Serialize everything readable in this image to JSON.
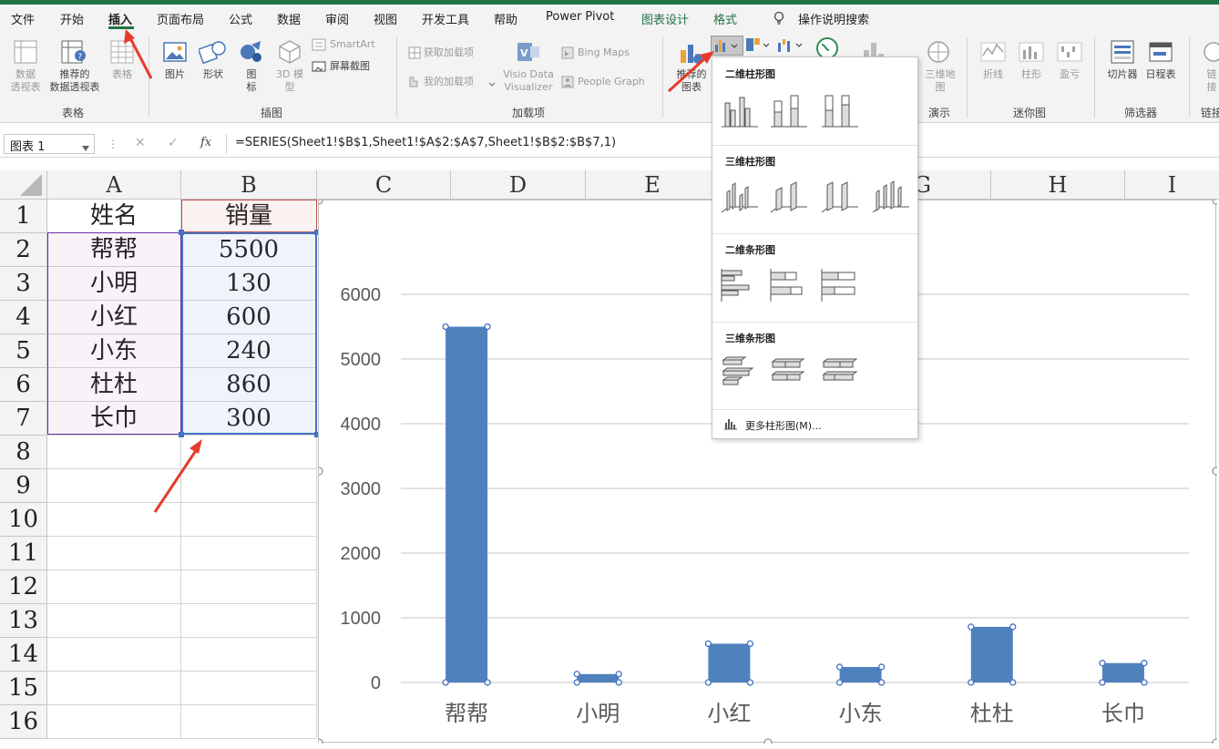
{
  "menu": {
    "file": "文件",
    "home": "开始",
    "insert": "插入",
    "layout": "页面布局",
    "formulas": "公式",
    "data": "数据",
    "review": "审阅",
    "view": "视图",
    "developer": "开发工具",
    "help": "帮助",
    "powerpivot": "Power Pivot",
    "chartdesign": "图表设计",
    "format": "格式",
    "tellme": "操作说明搜索"
  },
  "ribbon": {
    "pivot1": "数据",
    "pivot2": "透视表",
    "recpivot1": "推荐的",
    "recpivot2": "数据透视表",
    "table": "表格",
    "picture": "图片",
    "shapes": "形状",
    "icons1": "图",
    "icons2": "标",
    "model1": "3D 模",
    "model2": "型",
    "smartart": "SmartArt",
    "screenshot": "屏幕截图",
    "getaddins": "获取加载项",
    "myaddins": "我的加载项",
    "visio1": "Visio Data",
    "visio2": "Visualizer",
    "bingmaps": "Bing Maps",
    "peoplegraph": "People Graph",
    "recchart1": "推荐的",
    "recchart2": "图表",
    "map3d1": "三维地",
    "map3d2": "图",
    "line": "折线",
    "column": "柱形",
    "winloss": "盈亏",
    "slicer": "切片器",
    "timeline": "日程表",
    "link1": "链",
    "link2": "接",
    "groups": {
      "tables": "表格",
      "illustrations": "插图",
      "addins": "加载项",
      "tours": "演示",
      "sparklines": "迷你图",
      "filters": "筛选器",
      "links": "链接"
    }
  },
  "formula_bar": {
    "namebox": "图表 1",
    "fx": "fx",
    "formula": "=SERIES(Sheet1!$B$1,Sheet1!$A$2:$A$7,Sheet1!$B$2:$B$7,1)"
  },
  "columns": [
    "A",
    "B",
    "C",
    "D",
    "E",
    "G",
    "H",
    "I"
  ],
  "rows": [
    "1",
    "2",
    "3",
    "4",
    "5",
    "6",
    "7",
    "8",
    "9",
    "10",
    "11",
    "12",
    "13",
    "14",
    "15",
    "16"
  ],
  "cells": {
    "A1": "姓名",
    "B1": "销量",
    "A": [
      "帮帮",
      "小明",
      "小红",
      "小东",
      "杜杜",
      "长巾"
    ],
    "B": [
      "5500",
      "130",
      "600",
      "240",
      "860",
      "300"
    ]
  },
  "dropdown": {
    "col2d": "二维柱形图",
    "col3d": "三维柱形图",
    "bar2d": "二维条形图",
    "bar3d": "三维条形图",
    "more": "更多柱形图(M)..."
  },
  "chart_data": {
    "type": "bar",
    "categories": [
      "帮帮",
      "小明",
      "小红",
      "小东",
      "杜杜",
      "长巾"
    ],
    "values": [
      5500,
      130,
      600,
      240,
      860,
      300
    ],
    "ylim": [
      0,
      6000
    ],
    "yticks": [
      0,
      1000,
      2000,
      3000,
      4000,
      5000,
      6000
    ],
    "grid": true,
    "color": "#4f81bd"
  }
}
